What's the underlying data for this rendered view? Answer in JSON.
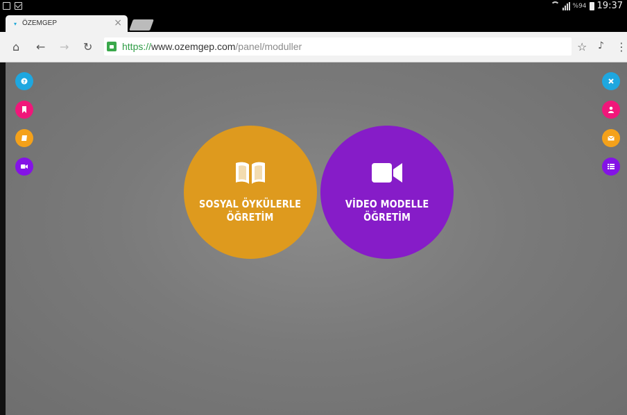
{
  "status_bar": {
    "battery_percent": "%94",
    "time": "19:37"
  },
  "tab": {
    "title": "ÖZEMGEP"
  },
  "address_bar": {
    "scheme": "https://",
    "host": "www.ozemgep.com",
    "path": "/panel/moduller"
  },
  "left_buttons": [
    {
      "icon": "question-icon",
      "color": "#1ea7e0"
    },
    {
      "icon": "bookmark-icon",
      "color": "#f0177a"
    },
    {
      "icon": "book-icon",
      "color": "#f4a11a"
    },
    {
      "icon": "video-camera-icon",
      "color": "#8413e6"
    }
  ],
  "right_buttons": [
    {
      "icon": "close-icon",
      "color": "#1ea7e0"
    },
    {
      "icon": "user-icon",
      "color": "#f0177a"
    },
    {
      "icon": "envelope-icon",
      "color": "#f4a11a"
    },
    {
      "icon": "list-icon",
      "color": "#8413e6"
    }
  ],
  "modules": [
    {
      "line1": "SOSYAL ÖYKÜLERLE",
      "line2": "ÖĞRETİM",
      "icon": "open-book-icon",
      "color": "#de9a1e"
    },
    {
      "line1": "VİDEO MODELLE",
      "line2": "ÖĞRETİM",
      "icon": "video-camera-icon",
      "color": "#861cc8"
    }
  ]
}
